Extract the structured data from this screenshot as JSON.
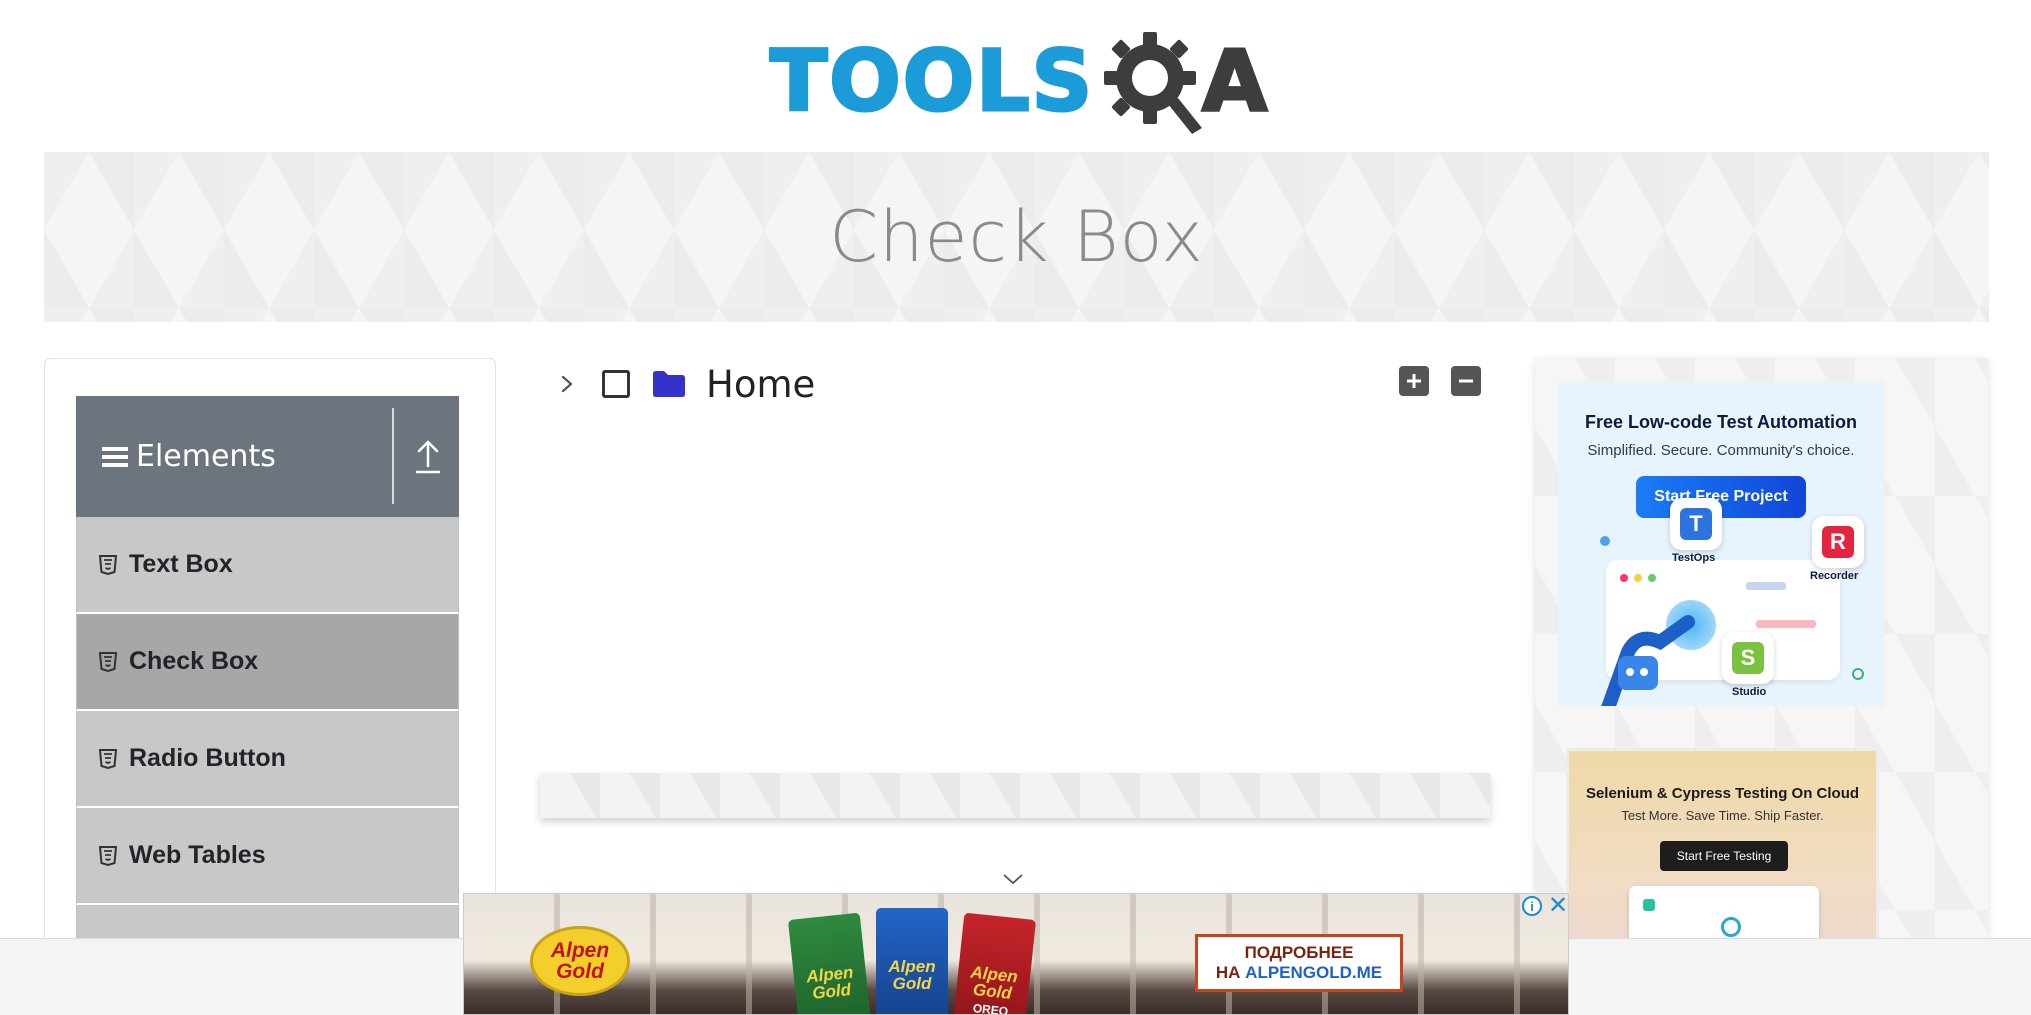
{
  "header": {
    "logo_text_left": "TOOLS",
    "logo_text_right": "A",
    "logo_alt": "TOOLSQA"
  },
  "page": {
    "title": "Check Box"
  },
  "sidebar": {
    "group_title": "Elements",
    "items": [
      {
        "label": "Text Box",
        "active": false
      },
      {
        "label": "Check Box",
        "active": true
      },
      {
        "label": "Radio Button",
        "active": false
      },
      {
        "label": "Web Tables",
        "active": false
      }
    ]
  },
  "tree": {
    "root_label": "Home",
    "checked": false,
    "expanded": false
  },
  "ads": {
    "right1": {
      "headline": "Free Low-code Test Automation",
      "sub": "Simplified. Secure. Community's choice.",
      "button": "Start Free Project",
      "tiles": [
        "TestOps",
        "Recorder",
        "Studio"
      ]
    },
    "right2": {
      "headline": "Selenium & Cypress Testing On Cloud",
      "sub": "Test More. Save Time. Ship Faster.",
      "button": "Start Free Testing"
    },
    "bottom": {
      "brand_line1": "Alpen",
      "brand_line2": "Gold",
      "bar_labels": [
        "Alpen\nGold",
        "Alpen\nGold",
        "Alpen\nGold"
      ],
      "bar3_extra": "OREO",
      "cta_line1": "ПОДРОБНЕЕ",
      "cta_line2_prefix": "НА",
      "cta_line2_link": "ALPENGOLD.ME",
      "info": "i",
      "close": "✕"
    }
  },
  "colors": {
    "brand_blue": "#1b9bd7",
    "brand_dark": "#3d3d3d",
    "sidebar_header": "#6c757d",
    "menu_item": "#c8c8c8",
    "menu_item_active": "#a7a7a7",
    "folder": "#3333cc"
  },
  "icons": {
    "menu": "hamburger-icon",
    "collapse": "upload-arrow-icon",
    "item": "html5-badge-icon",
    "expand": "chevron-right-icon",
    "folder": "folder-icon",
    "expand_all": "plus-square-icon",
    "collapse_all": "minus-square-icon",
    "scroll": "chevron-down-icon"
  }
}
